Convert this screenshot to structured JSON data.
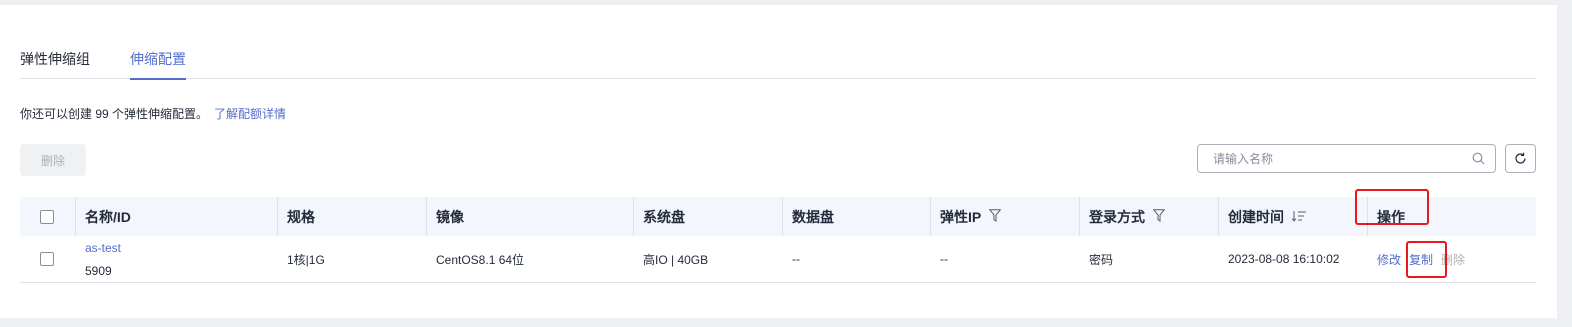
{
  "tabs": [
    {
      "label": "弹性伸缩组",
      "active": false
    },
    {
      "label": "伸缩配置",
      "active": true
    }
  ],
  "quota": {
    "text": "你还可以创建 99 个弹性伸缩配置。",
    "link": "了解配额详情"
  },
  "toolbar": {
    "delete_label": "删除",
    "search_placeholder": "请输入名称"
  },
  "icons": {
    "search": "search-icon",
    "refresh": "refresh-icon",
    "filter": "filter-icon",
    "sort": "sort-icon"
  },
  "colors": {
    "accent": "#526ecc",
    "highlight_box": "#e8181e",
    "header_bg": "#f3f6fc"
  },
  "table": {
    "columns": [
      {
        "label": "名称/ID"
      },
      {
        "label": "规格"
      },
      {
        "label": "镜像"
      },
      {
        "label": "系统盘"
      },
      {
        "label": "数据盘"
      },
      {
        "label": "弹性IP"
      },
      {
        "label": "登录方式"
      },
      {
        "label": "创建时间"
      },
      {
        "label": "操作"
      }
    ],
    "rows": [
      {
        "name": "as-test",
        "id": "5909",
        "spec": "1核|1G",
        "image": "CentOS8.1 64位",
        "system_disk": "高IO | 40GB",
        "data_disk": "--",
        "eip": "--",
        "login": "密码",
        "created": "2023-08-08 16:10:02",
        "actions": {
          "modify": "修改",
          "copy": "复制",
          "delete": "删除"
        }
      }
    ]
  }
}
